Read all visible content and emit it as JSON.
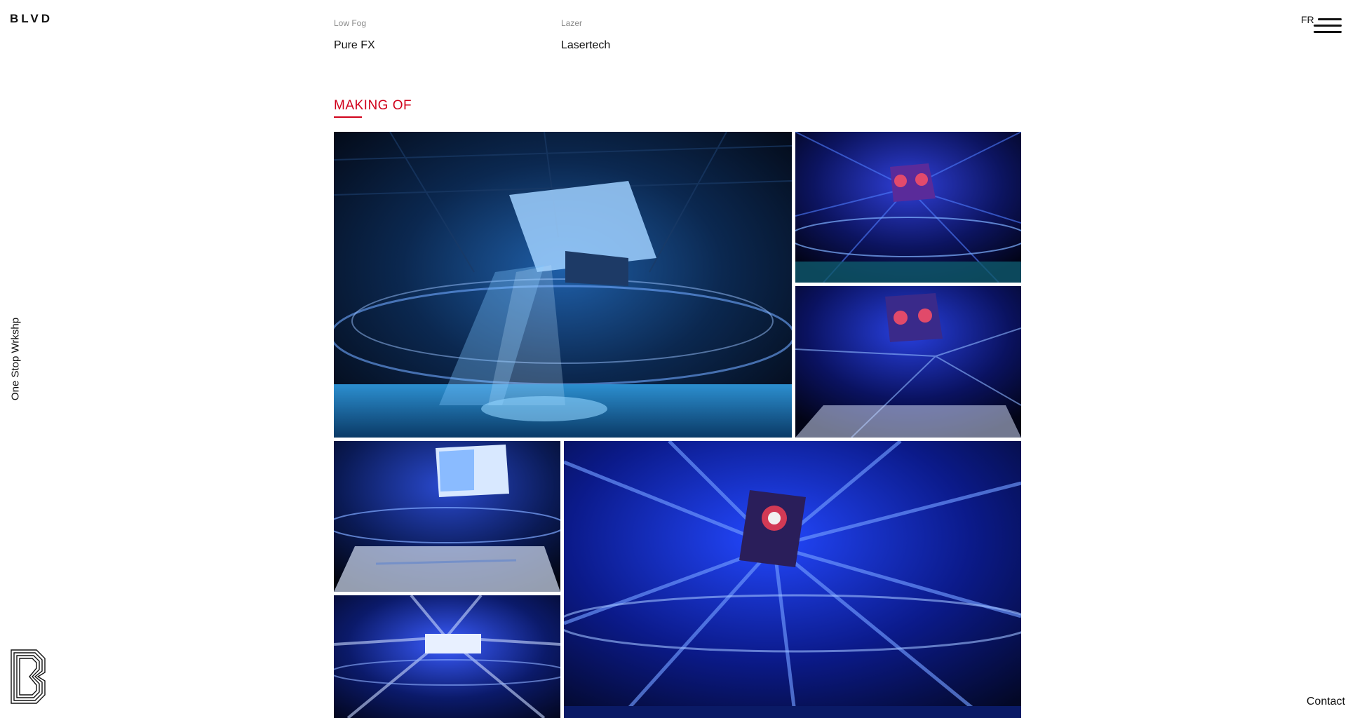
{
  "brand": {
    "logo_text": "BLVD",
    "tagline": "One Stop Wrkshp"
  },
  "header": {
    "lang_label": "FR",
    "menu_icon": "hamburger-menu-icon"
  },
  "credits": [
    {
      "role": "Low Fog",
      "name": "Pure FX"
    },
    {
      "role": "Lazer",
      "name": "Lasertech"
    }
  ],
  "section": {
    "title": "MAKING OF"
  },
  "footer": {
    "contact_label": "Contact",
    "monogram_icon": "blvd-monogram-icon"
  },
  "gallery": {
    "photo_count": 6,
    "subject": "arena lighting installation"
  },
  "colors": {
    "accent": "#d0021b",
    "text": "#111111",
    "muted": "#8a8a8a",
    "background": "#ffffff",
    "photo_blue": "#1e3cff"
  }
}
